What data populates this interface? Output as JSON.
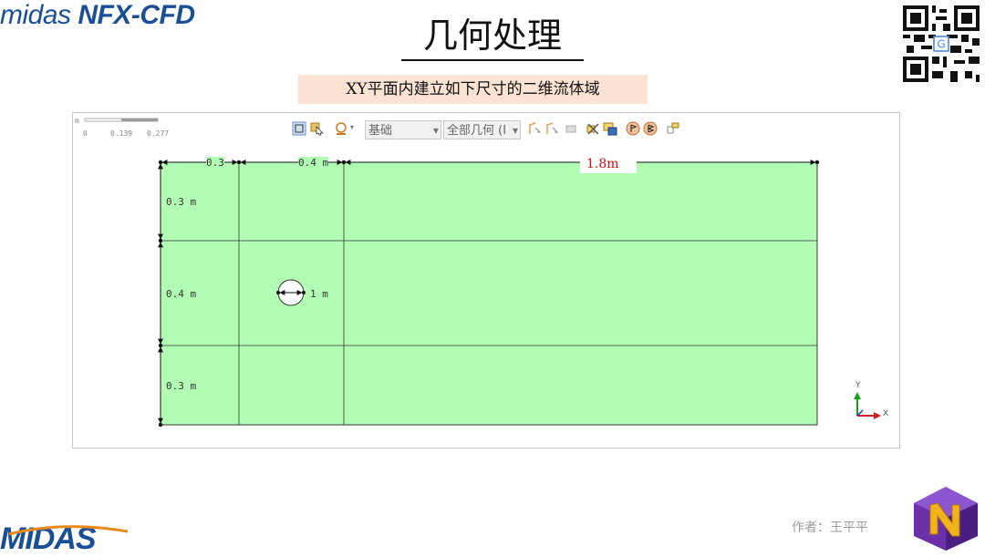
{
  "header": {
    "logo_prefix": "midas",
    "logo_brand": "NFX-CFD",
    "title": "几何处理",
    "subtitle": "XY平面内建立如下尺寸的二维流体域"
  },
  "scale_bar": {
    "ticks": [
      "0",
      "0.139",
      "0.277"
    ],
    "unit": "m"
  },
  "toolbar": {
    "selects": [
      {
        "name": "filter-select",
        "value": "基础"
      },
      {
        "name": "geometry-select",
        "value": "全部几何 (I"
      }
    ]
  },
  "dimensions": {
    "top_first": "0.3",
    "top_second": "0.4 m",
    "total_length": "1.8m",
    "left_top": "0.3 m",
    "left_middle": "0.4 m",
    "left_bottom": "0.3 m",
    "cylinder": "1 m"
  },
  "axis": {
    "y": "Y",
    "x": "X"
  },
  "footer": {
    "author": "作者：王平平",
    "logo_bottom": "MIDAS"
  },
  "colors": {
    "domain_fill": "#b2fdb4",
    "accent_red": "#d01010",
    "brand_blue": "#1a4f95"
  }
}
